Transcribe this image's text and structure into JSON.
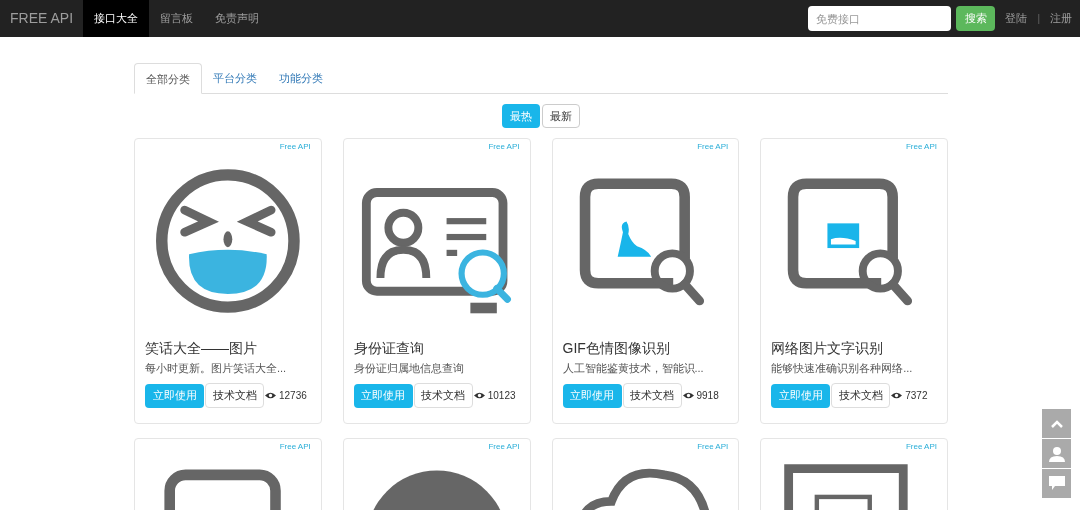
{
  "navbar": {
    "brand": "FREE API",
    "links": [
      {
        "label": "接口大全",
        "selected": true
      },
      {
        "label": "留言板",
        "selected": false
      },
      {
        "label": "免责声明",
        "selected": false
      }
    ],
    "search": {
      "placeholder": "免费接口"
    },
    "search_button": "搜索",
    "login": "登陆",
    "separator": "|",
    "register": "注册"
  },
  "category_tabs": [
    {
      "label": "全部分类",
      "selected": true
    },
    {
      "label": "平台分类",
      "selected": false
    },
    {
      "label": "功能分类",
      "selected": false
    }
  ],
  "sort_buttons": [
    {
      "label": "最热",
      "selected": true
    },
    {
      "label": "最新",
      "selected": false
    }
  ],
  "cards": [
    {
      "badge": "Free API",
      "kind": "laugh",
      "title": "笑话大全——图片",
      "description": "每小时更新。图片笑话大全...",
      "use_button": "立即使用",
      "docs_button": "技术文档",
      "views": "12736"
    },
    {
      "badge": "Free API",
      "kind": "idcard",
      "title": "身份证查询",
      "description": "身份证归属地信息查询",
      "use_button": "立即使用",
      "docs_button": "技术文档",
      "views": "10123"
    },
    {
      "badge": "Free API",
      "kind": "figure",
      "title": "GIF色情图像识别",
      "description": "人工智能鉴黄技术，智能识...",
      "use_button": "立即使用",
      "docs_button": "技术文档",
      "views": "9918"
    },
    {
      "badge": "Free API",
      "kind": "textimage",
      "title": "网络图片文字识别",
      "description": "能够快速准确识别各种网络...",
      "use_button": "立即使用",
      "docs_button": "技术文档",
      "views": "7372"
    },
    {
      "badge": "Free API",
      "kind": "frame"
    },
    {
      "badge": "Free API",
      "kind": "disc"
    },
    {
      "badge": "Free API",
      "kind": "cloud"
    },
    {
      "badge": "Free API",
      "kind": "window"
    }
  ]
}
